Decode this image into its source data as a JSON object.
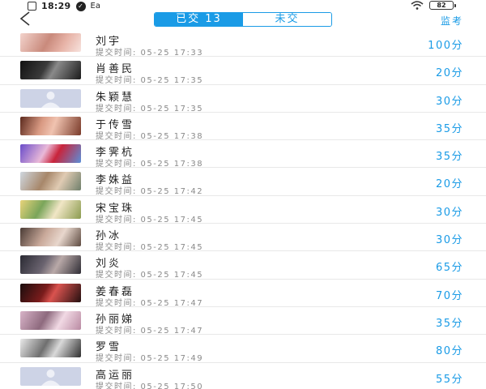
{
  "status_bar": {
    "time": "18:29",
    "sim_label": "Ea",
    "battery": "82"
  },
  "nav": {
    "tab_submitted": "已交 13",
    "tab_not_submitted": "未交",
    "monitor_label": "监考"
  },
  "colors": {
    "accent": "#1a9be6",
    "muted": "#8a8a8a",
    "divider": "#e8e8e8"
  },
  "students": [
    {
      "name": "刘宇",
      "time": "提交时间:  05-25 17:33",
      "score": "100分",
      "avatar": "photo-pink"
    },
    {
      "name": "肖善民",
      "time": "提交时间:  05-25 17:35",
      "score": "20分",
      "avatar": "photo-dark"
    },
    {
      "name": "朱颖慧",
      "time": "提交时间:  05-25 17:35",
      "score": "30分",
      "avatar": "default-silhouette"
    },
    {
      "name": "于传雪",
      "time": "提交时间:  05-25 17:38",
      "score": "35分",
      "avatar": "photo-face"
    },
    {
      "name": "李霁杭",
      "time": "提交时间:  05-25 17:38",
      "score": "35分",
      "avatar": "photo-cartoon"
    },
    {
      "name": "李姝益",
      "time": "提交时间:  05-25 17:42",
      "score": "20分",
      "avatar": "photo-outdoor"
    },
    {
      "name": "宋宝珠",
      "time": "提交时间:  05-25 17:45",
      "score": "30分",
      "avatar": "photo-flowers"
    },
    {
      "name": "孙冰",
      "time": "提交时间:  05-25 17:45",
      "score": "30分",
      "avatar": "photo-portrait"
    },
    {
      "name": "刘炎",
      "time": "提交时间:  05-25 17:45",
      "score": "65分",
      "avatar": "photo-dim"
    },
    {
      "name": "姜春磊",
      "time": "提交时间:  05-25 17:47",
      "score": "70分",
      "avatar": "photo-red"
    },
    {
      "name": "孙丽娣",
      "time": "提交时间:  05-25 17:47",
      "score": "35分",
      "avatar": "photo-pink2"
    },
    {
      "name": "罗雪",
      "time": "提交时间:  05-25 17:49",
      "score": "80分",
      "avatar": "photo-bw"
    },
    {
      "name": "高运丽",
      "time": "提交时间:  05-25 17:50",
      "score": "55分",
      "avatar": "default-silhouette"
    }
  ]
}
